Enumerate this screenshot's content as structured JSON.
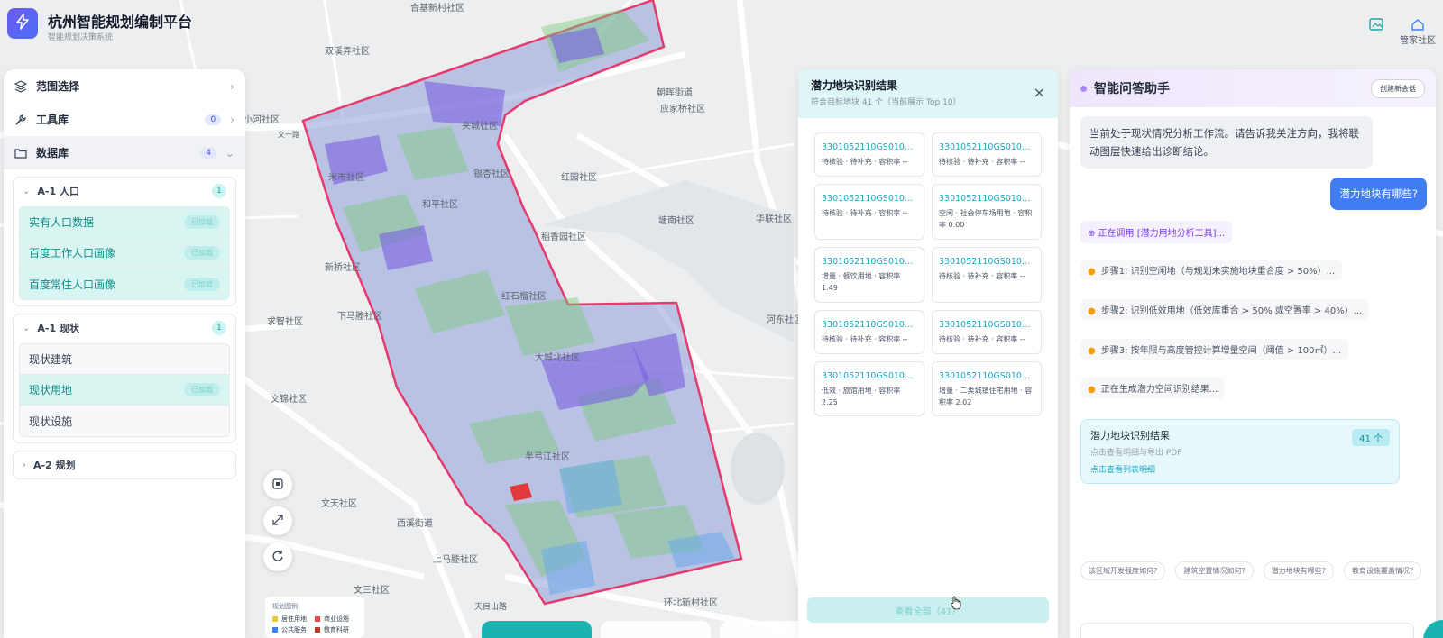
{
  "app": {
    "title": "杭州智能规划编制平台",
    "subtitle": "智能规划决策系统"
  },
  "header": {
    "right_label": "管家社区"
  },
  "map": {
    "labels": [
      "合基新村社区",
      "双溪弄社区",
      "朝晖街道",
      "应家桥社区",
      "小河社区",
      "夹城社区",
      "米市社区",
      "银杏社区",
      "红园社区",
      "和平社区",
      "稻香园社区",
      "塘南社区",
      "华联社区",
      "新桥社区",
      "求智社区",
      "下马塍社区",
      "红石榴社区",
      "河东社区",
      "大城北社区",
      "文锦社区",
      "半弓江社区",
      "文天社区",
      "西溪街道",
      "上马塍社区",
      "文三社区",
      "环北新村社区",
      "天目山路",
      "文一路"
    ]
  },
  "left": {
    "nav": [
      {
        "label": "范围选择",
        "icon": "layers-icon",
        "badge": ""
      },
      {
        "label": "工具库",
        "icon": "wrench-icon",
        "badge": "0"
      },
      {
        "label": "数据库",
        "icon": "folder-icon",
        "badge": "4"
      }
    ],
    "group1": {
      "title": "A-1 人口",
      "count": "1",
      "items": [
        {
          "label": "实有人口数据",
          "tag": "已加载"
        },
        {
          "label": "百度工作人口画像",
          "tag": "已加载"
        },
        {
          "label": "百度常住人口画像",
          "tag": "已加载"
        }
      ]
    },
    "group2": {
      "title": "A-1 现状",
      "count": "1",
      "items": [
        {
          "label": "现状建筑",
          "tag": ""
        },
        {
          "label": "现状用地",
          "tag": "已加载"
        },
        {
          "label": "现状设施",
          "tag": ""
        }
      ]
    },
    "group3": {
      "title": "A-2 规划"
    }
  },
  "legend": {
    "title": "规划图例",
    "items": [
      "居住用地",
      "商业设施",
      "公共服务",
      "教育科研"
    ],
    "colors": [
      "#e8c93a",
      "#e5484d",
      "#3b82f6",
      "#c0392b"
    ]
  },
  "results": {
    "title": "潜力地块识别结果",
    "subtitle": "符合目标地块 41 个（当前展示 Top 10）",
    "cards": [
      {
        "code": "3301052110GS010000...",
        "desc": "待核验 · 待补充 · 容积率 --"
      },
      {
        "code": "3301052110GS010000...",
        "desc": "待核验 · 待补充 · 容积率 --"
      },
      {
        "code": "3301052110GS010000...",
        "desc": "待核验 · 待补充 · 容积率 --"
      },
      {
        "code": "3301052110GS010000...",
        "desc": "空闲 · 社会停车场用地 · 容积率 0.00"
      },
      {
        "code": "3301052110GS010000...",
        "desc": "增量 · 餐饮用地 · 容积率 1.49"
      },
      {
        "code": "3301052110GS010000...",
        "desc": "待核验 · 待补充 · 容积率 --"
      },
      {
        "code": "3301052110GS010000...",
        "desc": "待核验 · 待补充 · 容积率 --"
      },
      {
        "code": "3301052110GS010000...",
        "desc": "待核验 · 待补充 · 容积率 --"
      },
      {
        "code": "3301052110GS010000...",
        "desc": "低效 · 旅馆用地 · 容积率 2.25"
      },
      {
        "code": "3301052110GS010000...",
        "desc": "增量 · 二类城镇住宅用地 · 容积率 2.02"
      }
    ],
    "view_all": "查看全部（41）"
  },
  "chat": {
    "title": "智能问答助手",
    "new_chat": "创建新会话",
    "ai_message": "当前处于现状情况分析工作流。请告诉我关注方向，我将联动图层快速给出诊断结论。",
    "user_message": "潜力地块有哪些?",
    "tool_call": "正在调用 [潜力用地分析工具]...",
    "steps": [
      "步骤1: 识别空闲地（与规划未实施地块重合度 > 50%）...",
      "步骤2: 识别低效用地（低效库重合 > 50% 或空置率 > 40%）...",
      "步骤3: 按年限与高度管控计算增量空间（阈值 > 100㎡）...",
      "正在生成潜力空间识别结果..."
    ],
    "result": {
      "title": "潜力地块识别结果",
      "sub": "点击查看明细与导出 PDF",
      "link": "点击查看列表明细",
      "count": "41 个"
    },
    "chips": [
      "该区域开发强度如何?",
      "建筑空置情况如何?",
      "潜力地块有哪些?",
      "教育设施覆盖情况?"
    ]
  }
}
